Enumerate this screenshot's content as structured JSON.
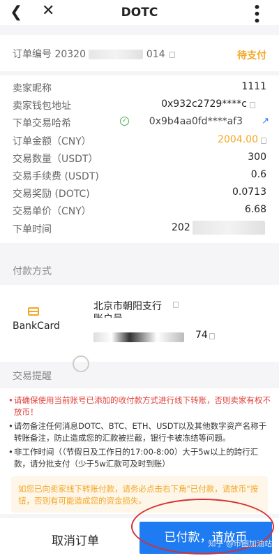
{
  "header": {
    "title": "DOTC"
  },
  "order": {
    "number_label": "订单编号",
    "number_prefix": "20320",
    "number_suffix": "014",
    "status": "待支付"
  },
  "details": [
    {
      "label": "卖家昵称",
      "value": "1111"
    },
    {
      "label": "卖家钱包地址",
      "value": "0x932c2729****c"
    },
    {
      "label": "下单交易哈希",
      "value": "0x9b4aa0fd****af3"
    },
    {
      "label": "订单金额（CNY）",
      "value": "2004.00"
    },
    {
      "label": "交易数量（USDT）",
      "value": "300"
    },
    {
      "label": "交易手续费 (USDT)",
      "value": "0.6"
    },
    {
      "label": "交易奖励 (DOTC)",
      "value": "0.0713"
    },
    {
      "label": "交易单价（CNY）",
      "value": "6.68"
    },
    {
      "label": "下单时间",
      "value": "202"
    }
  ],
  "payment": {
    "section_title": "付款方式",
    "method": "BankCard",
    "bank_branch": "北京市朝阳支行",
    "account_label": "账户号",
    "account_suffix": "74"
  },
  "notice": {
    "title": "交易提醒",
    "items": [
      "请确保使用当前账号已添加的收付款方式进行线下转账，否则卖家有权不放币！",
      "请勿备注任何消息DOTC、BTC、ETH、USDT以及其他数字资产名称于转账备注，防止造成您的汇款被拦截，银行卡被冻结等问题。",
      "非工作时间（（节假日及工作日的17:00-8:00）大于5w以上的跨行汇款，请分批支付（少于5w汇款可及时到账）"
    ],
    "warning": "如您已向卖家线下转账付款，请务必点击右下角\"已付款，请放币\"按钮，否则有可能造成您的资金损失。"
  },
  "actions": {
    "cancel_label": "取消订单",
    "pay_label": "已付款，请放币"
  },
  "watermark": "知乎 @币圈加油站",
  "colors": {
    "status": "#f5a623",
    "primary_button": "#1e7bf2",
    "warning_text": "#e0403a",
    "highlight_ring": "#d63032"
  }
}
